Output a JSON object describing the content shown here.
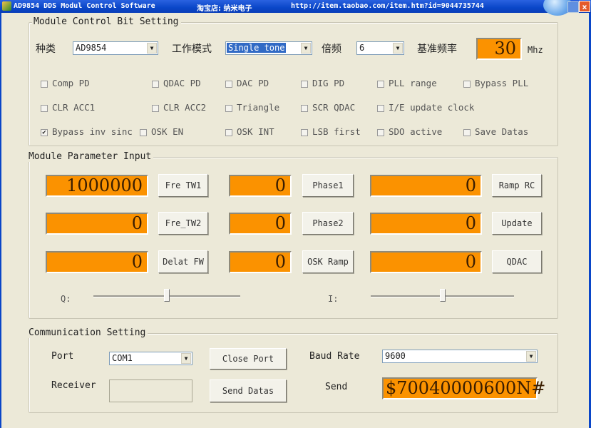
{
  "window": {
    "title": "AD9854 DDS Modul Control Software",
    "shop": "淘宝店: 纳米电子",
    "url": "http://item.taobao.com/item.htm?id=9044735744",
    "close_glyph": "×"
  },
  "control_bits": {
    "legend": "Module Control Bit Setting",
    "type_label": "种类",
    "type_value": "AD9854",
    "mode_label": "工作模式",
    "mode_value": "Single tone",
    "mult_label": "倍频",
    "mult_value": "6",
    "ref_label": "基准频率",
    "ref_value": "30",
    "ref_unit": "Mhz",
    "checkboxes": [
      {
        "label": "Comp PD",
        "checked": false
      },
      {
        "label": "QDAC PD",
        "checked": false
      },
      {
        "label": "DAC PD",
        "checked": false
      },
      {
        "label": "DIG PD",
        "checked": false
      },
      {
        "label": "PLL range",
        "checked": false
      },
      {
        "label": "Bypass PLL",
        "checked": false
      },
      {
        "label": "CLR ACC1",
        "checked": false
      },
      {
        "label": "CLR ACC2",
        "checked": false
      },
      {
        "label": "Triangle",
        "checked": false
      },
      {
        "label": "SCR QDAC",
        "checked": false
      },
      {
        "label": "I/E update clock",
        "checked": false
      },
      {
        "label": "Bypass inv sinc",
        "checked": true
      },
      {
        "label": "OSK EN",
        "checked": false
      },
      {
        "label": "OSK INT",
        "checked": false
      },
      {
        "label": "LSB first",
        "checked": false
      },
      {
        "label": "SDO active",
        "checked": false
      },
      {
        "label": "Save Datas",
        "checked": false
      }
    ],
    "check_mark": "✔"
  },
  "params": {
    "legend": "Module Parameter Input",
    "rows": [
      [
        {
          "value": "1000000",
          "button": "Fre TW1"
        },
        {
          "value": "0",
          "button": "Phase1"
        },
        {
          "value": "0",
          "button": "Ramp RC"
        }
      ],
      [
        {
          "value": "0",
          "button": "Fre_TW2"
        },
        {
          "value": "0",
          "button": "Phase2"
        },
        {
          "value": "0",
          "button": "Update"
        }
      ],
      [
        {
          "value": "0",
          "button": "Delat FW"
        },
        {
          "value": "0",
          "button": "OSK Ramp"
        },
        {
          "value": "0",
          "button": "QDAC"
        }
      ]
    ],
    "q_label": "Q:",
    "i_label": "I:",
    "q_slider_fraction": 0.5,
    "i_slider_fraction": 0.5
  },
  "comm": {
    "legend": "Communication Setting",
    "port_label": "Port",
    "port_value": "COM1",
    "receiver_label": "Receiver",
    "receiver_value": "",
    "close_port": "Close Port",
    "send_datas": "Send Datas",
    "baud_label": "Baud Rate",
    "baud_value": "9600",
    "send_label": "Send",
    "send_value": "$70040000600N#"
  },
  "colors": {
    "field_orange": "#fb9200",
    "titlebar_blue": "#0a46c8",
    "window_bg": "#ece9d8"
  }
}
